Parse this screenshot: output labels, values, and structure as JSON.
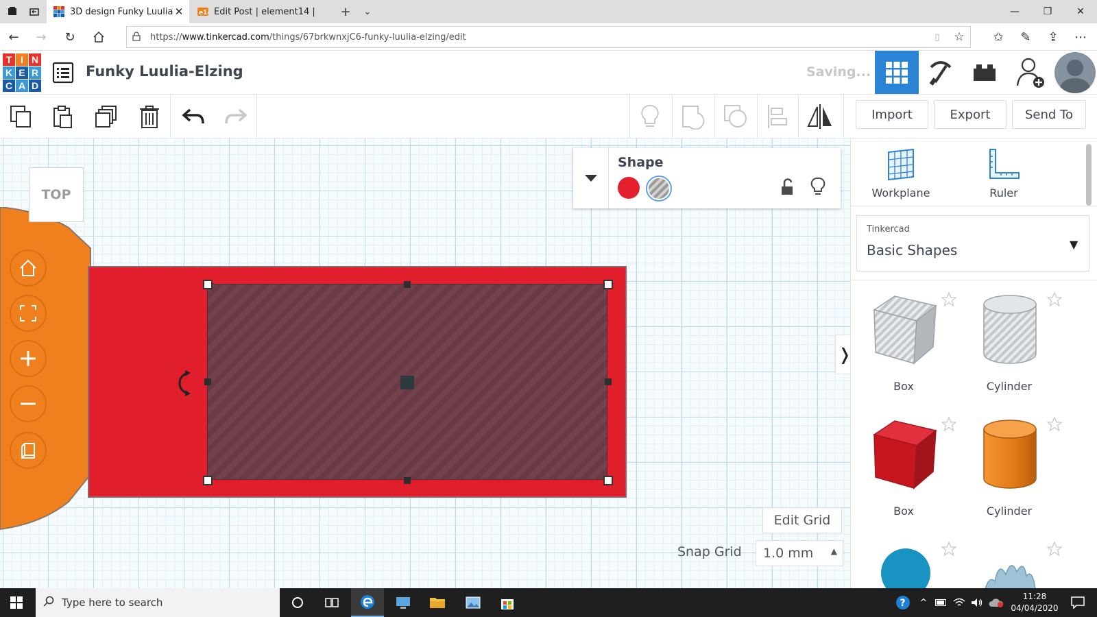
{
  "browser": {
    "tabs": [
      {
        "title": "3D design Funky Luulia-",
        "active": true
      },
      {
        "title": "Edit Post | element14 |",
        "active": false
      }
    ],
    "url_prefix": "https://",
    "url_domain": "www.tinkercad.com",
    "url_path": "/things/67brkwnxjC6-funky-luulia-elzing/edit"
  },
  "app": {
    "logo_letters": [
      "T",
      "I",
      "N",
      "K",
      "E",
      "R",
      "C",
      "A",
      "D"
    ],
    "logo_colors": [
      "#e5332a",
      "#f07f1e",
      "#e5332a",
      "#3a9ad9",
      "#1a5aa6",
      "#3a9ad9",
      "#1a5aa6",
      "#3a9ad9",
      "#1a5aa6"
    ],
    "design_title": "Funky Luulia-Elzing",
    "status": "Saving...",
    "accent": "#2b83d6"
  },
  "toolbar": {
    "import_label": "Import",
    "export_label": "Export",
    "send_to_label": "Send To"
  },
  "viewport": {
    "viewcube_label": "TOP"
  },
  "inspector": {
    "title": "Shape",
    "solid_color": "#e5202e"
  },
  "grid": {
    "edit_grid_label": "Edit Grid",
    "snap_grid_label": "Snap Grid",
    "snap_grid_value": "1.0 mm"
  },
  "shapes_panel": {
    "tools": [
      {
        "label": "Workplane",
        "icon": "workplane-icon"
      },
      {
        "label": "Ruler",
        "icon": "ruler-icon"
      }
    ],
    "library_category": "Tinkercad",
    "library_name": "Basic Shapes",
    "items": [
      {
        "label": "Box",
        "kind": "hole"
      },
      {
        "label": "Cylinder",
        "kind": "hole"
      },
      {
        "label": "Box",
        "kind": "solid"
      },
      {
        "label": "Cylinder",
        "kind": "solid"
      }
    ]
  },
  "taskbar": {
    "search_placeholder": "Type here to search",
    "time": "11:28",
    "date": "04/04/2020"
  }
}
